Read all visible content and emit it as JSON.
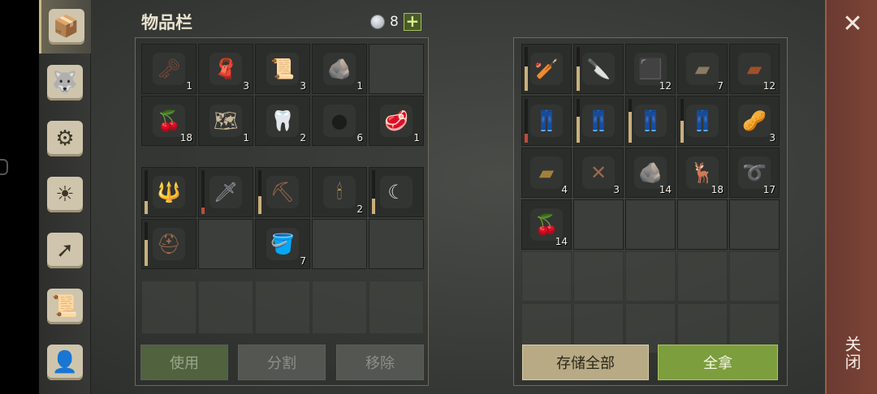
{
  "inventory": {
    "title": "物品栏",
    "currency_count": "8",
    "plus_label": "+",
    "items": [
      {
        "name": "key-icon",
        "glyph": "🗝",
        "color": "#7a4a3a",
        "count": "1"
      },
      {
        "name": "leather-icon",
        "glyph": "🧣",
        "color": "#5a3a2a",
        "count": "3"
      },
      {
        "name": "hide-scroll-icon",
        "glyph": "📜",
        "color": "#6a4028",
        "count": "3"
      },
      {
        "name": "stone-icon",
        "glyph": "🪨",
        "color": "#8a8a88",
        "count": "1"
      },
      {
        "name": "empty",
        "glyph": "",
        "color": "",
        "count": ""
      },
      {
        "name": "berries-icon",
        "glyph": "🍒",
        "color": "#b02a2a",
        "count": "18"
      },
      {
        "name": "map-scroll-icon",
        "glyph": "🗺",
        "color": "#c9b89a",
        "count": "1"
      },
      {
        "name": "fang-icon",
        "glyph": "🦷",
        "color": "#d7cfbd",
        "count": "2"
      },
      {
        "name": "coal-icon",
        "glyph": "●",
        "color": "#1c1c1c",
        "count": "6"
      },
      {
        "name": "meat-bowl-icon",
        "glyph": "🥩",
        "color": "#b55a6a",
        "count": "1"
      }
    ],
    "equipment": [
      {
        "name": "mace-icon",
        "glyph": "🔱",
        "color": "#6a4a3a",
        "count": "",
        "durability": 0.3,
        "dur_color": "#c9b07a"
      },
      {
        "name": "sword-icon",
        "glyph": "🗡",
        "color": "#9aa0a8",
        "count": "",
        "durability": 0.15,
        "dur_color": "#c04a3a"
      },
      {
        "name": "shovel-icon",
        "glyph": "⛏",
        "color": "#9a6a4a",
        "count": "",
        "durability": 0.4,
        "dur_color": "#c9b07a"
      },
      {
        "name": "candle-icon",
        "glyph": "🕯",
        "color": "#c9a05a",
        "count": "2"
      },
      {
        "name": "sickle-icon",
        "glyph": "☾",
        "color": "#d0d0d0",
        "count": "",
        "durability": 0.35,
        "dur_color": "#c9b07a"
      },
      {
        "name": "helmet-icon",
        "glyph": "⛑",
        "color": "#9a6a4a",
        "count": "",
        "durability": 0.6,
        "dur_color": "#c9b07a"
      },
      {
        "name": "empty",
        "glyph": "",
        "color": "",
        "count": ""
      },
      {
        "name": "berry-bucket-icon",
        "glyph": "🪣",
        "color": "#c07a4a",
        "count": "7"
      },
      {
        "name": "empty",
        "glyph": "",
        "color": "",
        "count": ""
      },
      {
        "name": "empty",
        "glyph": "",
        "color": "",
        "count": ""
      }
    ],
    "buttons": {
      "use": "使用",
      "split": "分割",
      "remove": "移除"
    }
  },
  "storage": {
    "items": [
      {
        "name": "spiked-club-icon",
        "glyph": "🏏",
        "color": "#7a5a3a",
        "count": "",
        "durability": 0.55,
        "dur_color": "#c9b07a"
      },
      {
        "name": "machete-icon",
        "glyph": "🔪",
        "color": "#b09a7a",
        "count": "",
        "durability": 0.55,
        "dur_color": "#c9b07a"
      },
      {
        "name": "stone-block-icon",
        "glyph": "⬛",
        "color": "#7a7a78",
        "count": "12"
      },
      {
        "name": "plank-icon",
        "glyph": "▰",
        "color": "#8a7a60",
        "count": "7"
      },
      {
        "name": "copper-ingot-icon",
        "glyph": "▰",
        "color": "#a0502a",
        "count": "12"
      },
      {
        "name": "pants-icon",
        "glyph": "👖",
        "color": "#3a3040",
        "count": "",
        "durability": 0.2,
        "dur_color": "#c04a3a"
      },
      {
        "name": "pants-icon",
        "glyph": "👖",
        "color": "#3a3040",
        "count": "",
        "durability": 0.6,
        "dur_color": "#c9b07a"
      },
      {
        "name": "pants-icon",
        "glyph": "👖",
        "color": "#3a3040",
        "count": "",
        "durability": 0.7,
        "dur_color": "#c9b07a"
      },
      {
        "name": "pants-icon",
        "glyph": "👖",
        "color": "#3a3040",
        "count": "",
        "durability": 0.5,
        "dur_color": "#c9b07a"
      },
      {
        "name": "nuts-icon",
        "glyph": "🥜",
        "color": "#8a6a3a",
        "count": "3"
      },
      {
        "name": "iron-ingot-icon",
        "glyph": "▰",
        "color": "#a0803a",
        "count": "4"
      },
      {
        "name": "nails-icon",
        "glyph": "✕",
        "color": "#9a6a4a",
        "count": "3"
      },
      {
        "name": "rock-icon",
        "glyph": "🪨",
        "color": "#6a6a68",
        "count": "14"
      },
      {
        "name": "animal-hide-icon",
        "glyph": "🦌",
        "color": "#8a5a3a",
        "count": "18"
      },
      {
        "name": "rope-icon",
        "glyph": "➰",
        "color": "#b0946a",
        "count": "17"
      },
      {
        "name": "berries-icon",
        "glyph": "🍒",
        "color": "#b02a2a",
        "count": "14"
      }
    ],
    "buttons": {
      "store_all": "存储全部",
      "take_all": "全拿"
    }
  },
  "close": {
    "label": "关闭",
    "x": "✕"
  },
  "tabs": [
    {
      "name": "chest-tab-icon",
      "glyph": "📦"
    },
    {
      "name": "wolf-tab-icon",
      "glyph": "🐺"
    },
    {
      "name": "crafting-tab-icon",
      "glyph": "⚙"
    },
    {
      "name": "journal-tab-icon",
      "glyph": "☀"
    },
    {
      "name": "map-tab-icon",
      "glyph": "➚"
    },
    {
      "name": "scroll-tab-icon",
      "glyph": "📜"
    },
    {
      "name": "character-tab-icon",
      "glyph": "👤"
    }
  ]
}
